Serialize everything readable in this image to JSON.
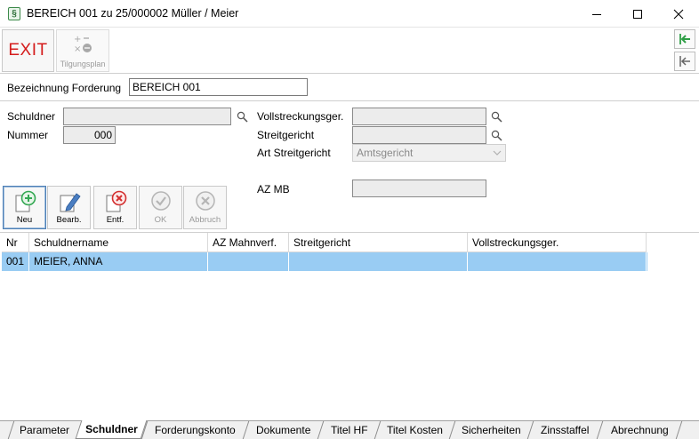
{
  "window": {
    "title": "BEREICH 001 zu 25/000002 Müller / Meier",
    "app_icon_glyph": "§"
  },
  "toolbar": {
    "exit_label": "EXIT",
    "tilgungsplan_label": "Tilgungsplan"
  },
  "form": {
    "bezeichnung_label": "Bezeichnung Forderung",
    "bezeichnung_value": "BEREICH 001",
    "schuldner_label": "Schuldner",
    "schuldner_value": "",
    "nummer_label": "Nummer",
    "nummer_value": "000",
    "vollstreckungsger_label": "Vollstreckungsger.",
    "vollstreckungsger_value": "",
    "streitgericht_label": "Streitgericht",
    "streitgericht_value": "",
    "art_streitgericht_label": "Art Streitgericht",
    "art_streitgericht_value": "Amtsgericht",
    "az_mb_label": "AZ MB",
    "az_mb_value": ""
  },
  "actions": {
    "neu": "Neu",
    "bearb": "Bearb.",
    "entf": "Entf.",
    "ok": "OK",
    "abbruch": "Abbruch"
  },
  "table": {
    "columns": [
      "Nr",
      "Schuldnername",
      "AZ Mahnverf.",
      "Streitgericht",
      "Vollstreckungsger."
    ],
    "rows": [
      [
        "001",
        "MEIER, ANNA",
        "",
        "",
        ""
      ]
    ]
  },
  "tabs": [
    {
      "label": "Parameter",
      "selected": false
    },
    {
      "label": "Schuldner",
      "selected": true
    },
    {
      "label": "Forderungskonto",
      "selected": false
    },
    {
      "label": "Dokumente",
      "selected": false
    },
    {
      "label": "Titel HF",
      "selected": false
    },
    {
      "label": "Titel Kosten",
      "selected": false
    },
    {
      "label": "Sicherheiten",
      "selected": false
    },
    {
      "label": "Zinsstaffel",
      "selected": false
    },
    {
      "label": "Abrechnung",
      "selected": false
    }
  ],
  "colors": {
    "selected_row": "#99ccf3",
    "exit_text": "#d41c1c",
    "green_arrow": "#2e9e45",
    "add_green": "#34a853",
    "delete_red": "#d32f2f"
  }
}
